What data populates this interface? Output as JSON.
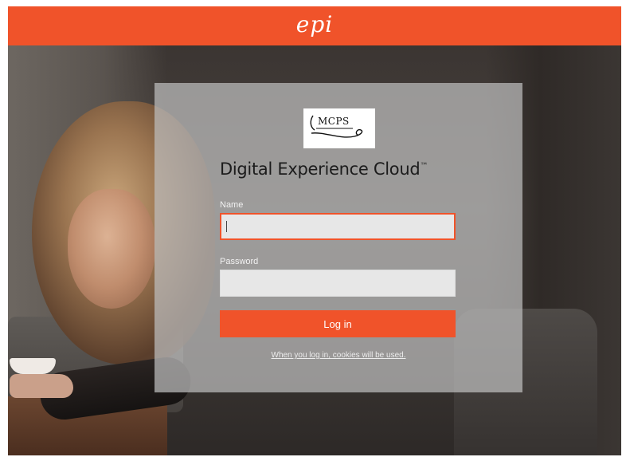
{
  "header": {
    "brand_logo_text": "epi",
    "accent_color": "#f0532a"
  },
  "login": {
    "client_logo_text": "MCPS",
    "title": "Digital Experience Cloud",
    "title_mark": "™",
    "name_label": "Name",
    "name_value": "",
    "password_label": "Password",
    "password_value": "",
    "button_label": "Log in",
    "cookie_notice": "When you log in, cookies will be used."
  }
}
